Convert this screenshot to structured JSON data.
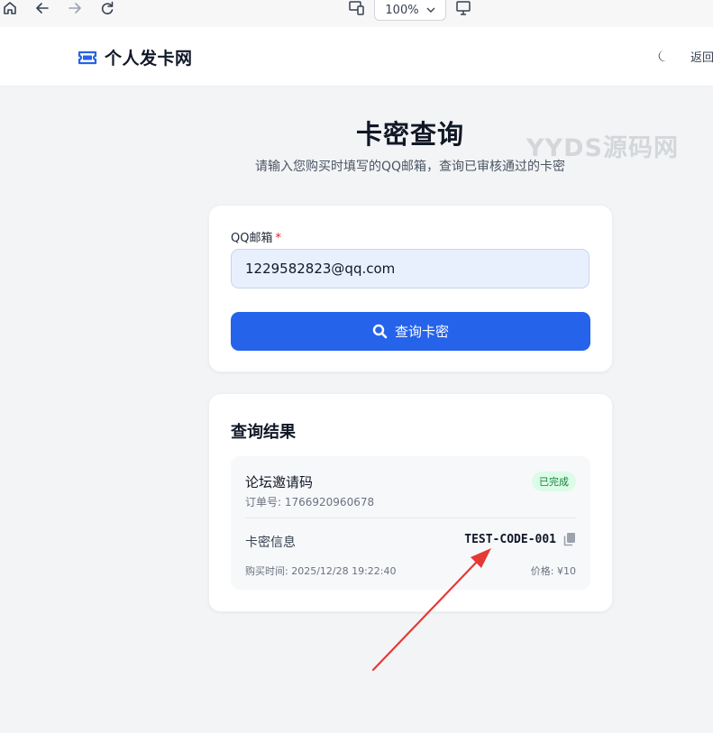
{
  "browser": {
    "zoom": "100%"
  },
  "header": {
    "brand_title": "个人发卡网",
    "back_label": "返回"
  },
  "page": {
    "title": "卡密查询",
    "subtitle": "请输入您购买时填写的QQ邮箱，查询已审核通过的卡密",
    "watermark": "YYDS源码网"
  },
  "form": {
    "email_label": "QQ邮箱",
    "required_mark": "*",
    "email_value": "1229582823@qq.com",
    "submit_label": "查询卡密"
  },
  "results": {
    "title": "查询结果",
    "items": [
      {
        "product_name": "论坛邀请码",
        "order_no": "订单号: 1766920960678",
        "status": "已完成",
        "card_label": "卡密信息",
        "card_code": "TEST-CODE-001",
        "purchase_time": "购买时间: 2025/12/28 19:22:40",
        "price": "价格: ¥10"
      }
    ]
  },
  "colors": {
    "primary": "#2563eb",
    "status_bg": "#dcfce7",
    "status_text": "#15803d",
    "annotation_arrow": "#e53935"
  }
}
